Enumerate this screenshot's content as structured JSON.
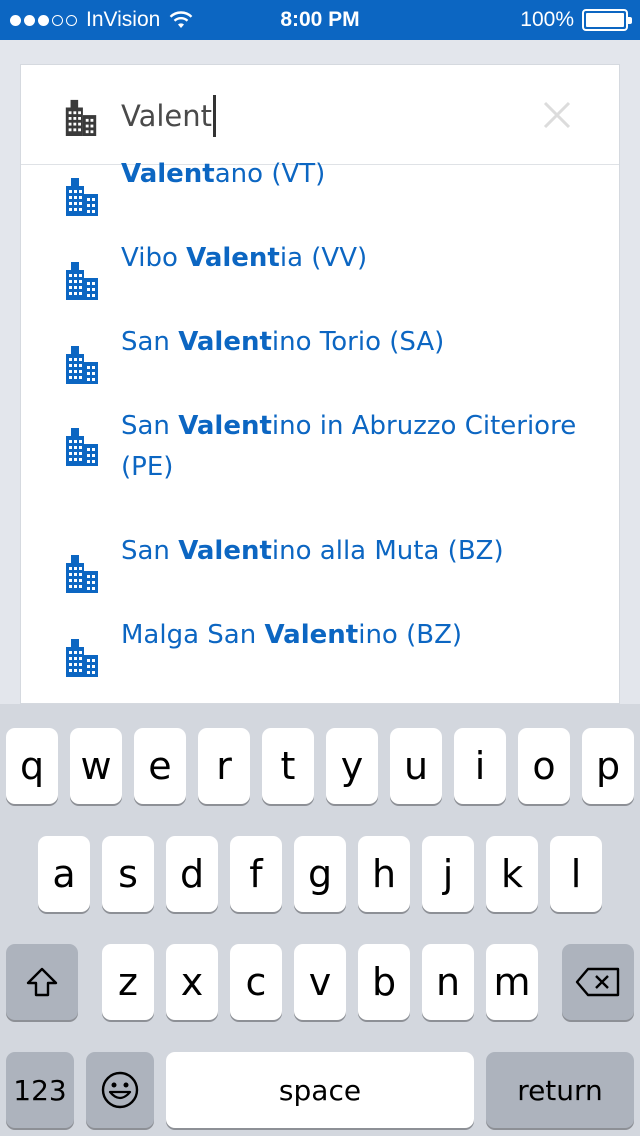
{
  "status_bar": {
    "carrier": "InVision",
    "time": "8:00 PM",
    "battery": "100%",
    "signal_bars_filled": 3,
    "signal_bars_total": 5
  },
  "search": {
    "value": "Valent",
    "icon": "building-icon",
    "clear_icon": "close-icon"
  },
  "results": [
    {
      "prefix": "",
      "match": "Valent",
      "suffix": "ano (VT)"
    },
    {
      "prefix": "Vibo ",
      "match": "Valent",
      "suffix": "ia (VV)"
    },
    {
      "prefix": "San ",
      "match": "Valent",
      "suffix": "ino Torio (SA)"
    },
    {
      "prefix": "San ",
      "match": "Valent",
      "suffix": "ino in Abruzzo Citeriore (PE)"
    },
    {
      "prefix": "San ",
      "match": "Valent",
      "suffix": "ino alla Muta (BZ)"
    },
    {
      "prefix": "Malga San ",
      "match": "Valent",
      "suffix": "ino (BZ)"
    }
  ],
  "keyboard": {
    "row1": [
      "q",
      "w",
      "e",
      "r",
      "t",
      "y",
      "u",
      "i",
      "o",
      "p"
    ],
    "row2": [
      "a",
      "s",
      "d",
      "f",
      "g",
      "h",
      "j",
      "k",
      "l"
    ],
    "row3": [
      "z",
      "x",
      "c",
      "v",
      "b",
      "n",
      "m"
    ],
    "numbers_label": "123",
    "space_label": "space",
    "return_label": "return",
    "shift_icon": "shift-icon",
    "delete_icon": "backspace-icon",
    "emoji_icon": "emoji-icon"
  },
  "colors": {
    "accent": "#0c66c2",
    "icon_dark": "#3a3a3a"
  }
}
